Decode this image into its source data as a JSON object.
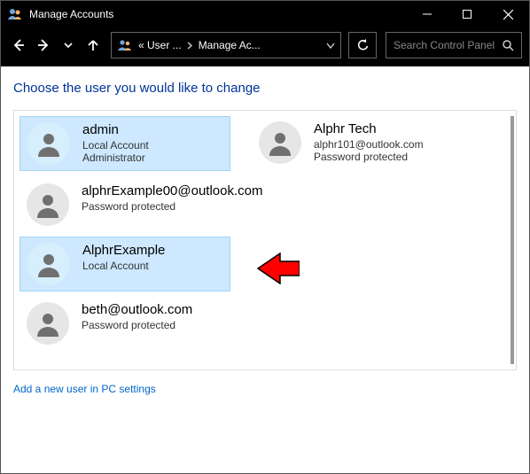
{
  "window": {
    "title": "Manage Accounts"
  },
  "address": {
    "seg1": "« User ...",
    "seg2": "Manage Ac..."
  },
  "search": {
    "placeholder": "Search Control Panel"
  },
  "heading": "Choose the user you would like to change",
  "users": {
    "u0": {
      "name": "admin",
      "line1": "Local Account",
      "line2": "Administrator"
    },
    "u1": {
      "name": "Alphr Tech",
      "line1": "alphr101@outlook.com",
      "line2": "Password protected"
    },
    "u2": {
      "name": "alphrExample00@outlook.com",
      "line1": "Password protected"
    },
    "u3": {
      "name": "AlphrExample",
      "line1": "Local Account"
    },
    "u4": {
      "name": "beth@outlook.com",
      "line1": "Password protected"
    }
  },
  "footer": {
    "add_link": "Add a new user in PC settings"
  }
}
